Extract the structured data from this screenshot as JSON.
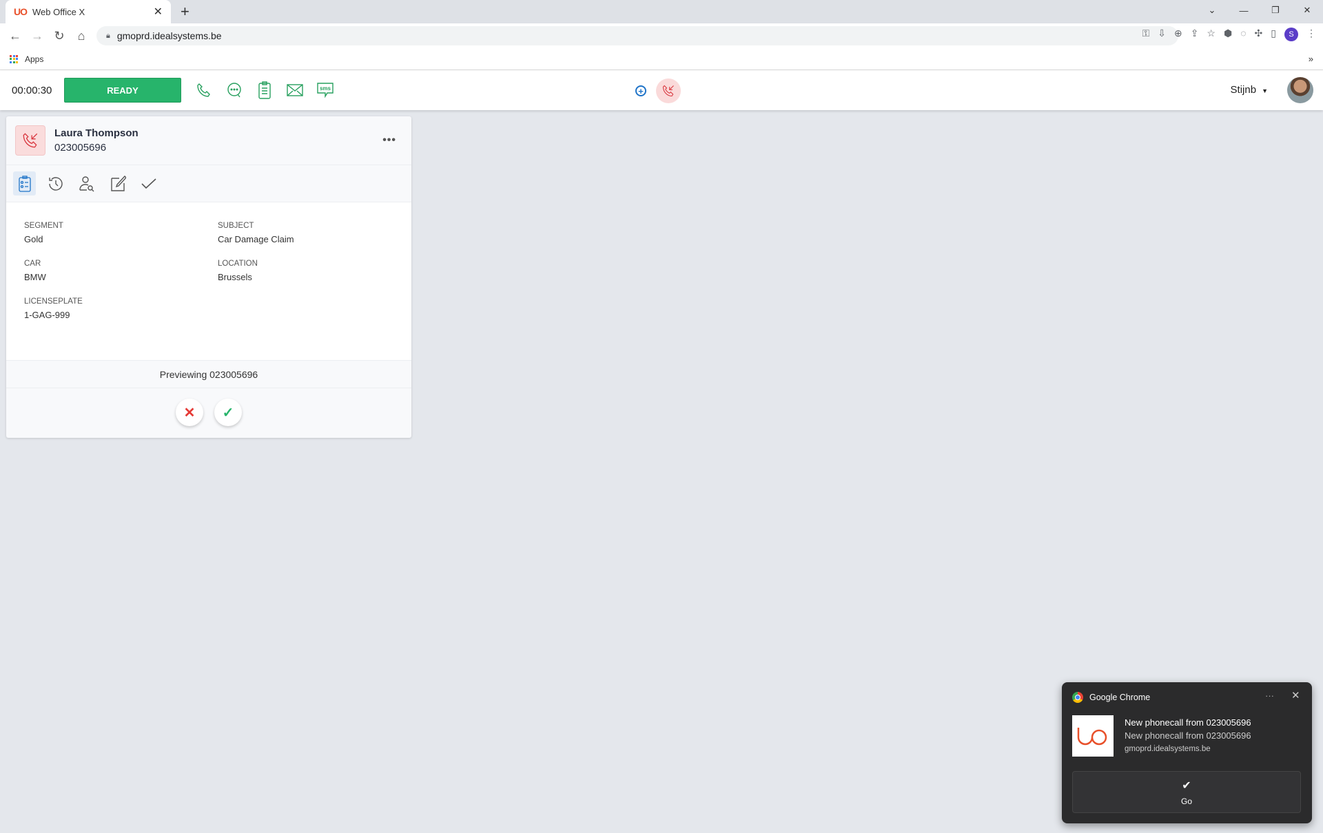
{
  "browser": {
    "tab_title": "Web Office X",
    "url": "gmoprd.idealsystems.be",
    "bookmark": "Apps",
    "profile_initial": "S"
  },
  "toolbar": {
    "timer": "00:00:30",
    "status_label": "READY",
    "status_color": "#27b46b",
    "channels": [
      "phone-icon",
      "chat-icon",
      "clipboard-icon",
      "mail-icon",
      "sms-icon"
    ],
    "sms_text": "sms",
    "user": "Stijnb"
  },
  "card": {
    "name": "Laura Thompson",
    "phone": "023005696",
    "fields": [
      {
        "label": "SEGMENT",
        "value": "Gold"
      },
      {
        "label": "SUBJECT",
        "value": "Car Damage Claim"
      },
      {
        "label": "CAR",
        "value": "BMW"
      },
      {
        "label": "LOCATION",
        "value": "Brussels"
      },
      {
        "label": "LICENSEPLATE",
        "value": "1-GAG-999"
      }
    ],
    "preview": "Previewing 023005696"
  },
  "notification": {
    "app": "Google Chrome",
    "title": "New phonecall from 023005696",
    "body": "New phonecall from 023005696",
    "origin": "gmoprd.idealsystems.be",
    "action": "Go"
  }
}
